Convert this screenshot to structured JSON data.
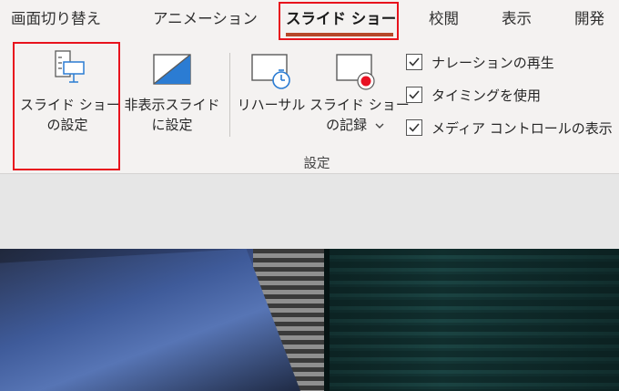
{
  "tabs": [
    {
      "label": "画面切り替え"
    },
    {
      "label": "アニメーション"
    },
    {
      "label": "スライド ショー"
    },
    {
      "label": "校閲"
    },
    {
      "label": "表示"
    },
    {
      "label": "開発"
    }
  ],
  "active_tab": "スライド ショー",
  "ribbon": {
    "buttons": [
      {
        "line1": "スライド ショー",
        "line2": "の設定",
        "icon": "slideshow-setup-icon"
      },
      {
        "line1": "非表示スライド",
        "line2": "に設定",
        "icon": "hide-slide-icon"
      },
      {
        "line1": "リハーサル",
        "line2": "",
        "icon": "rehearse-timings-icon"
      },
      {
        "line1": "スライド ショー",
        "line2": "の記録",
        "icon": "record-slideshow-icon"
      }
    ],
    "checkboxes": [
      {
        "label": "ナレーションの再生",
        "checked": true
      },
      {
        "label": "タイミングを使用",
        "checked": true
      },
      {
        "label": "メディア コントロールの表示",
        "checked": true
      }
    ],
    "group_label": "設定"
  },
  "colors": {
    "highlight": "#e8131d",
    "active_underline": "#b7472a",
    "accent_blue": "#2b7cd3",
    "record_red": "#e81123"
  }
}
